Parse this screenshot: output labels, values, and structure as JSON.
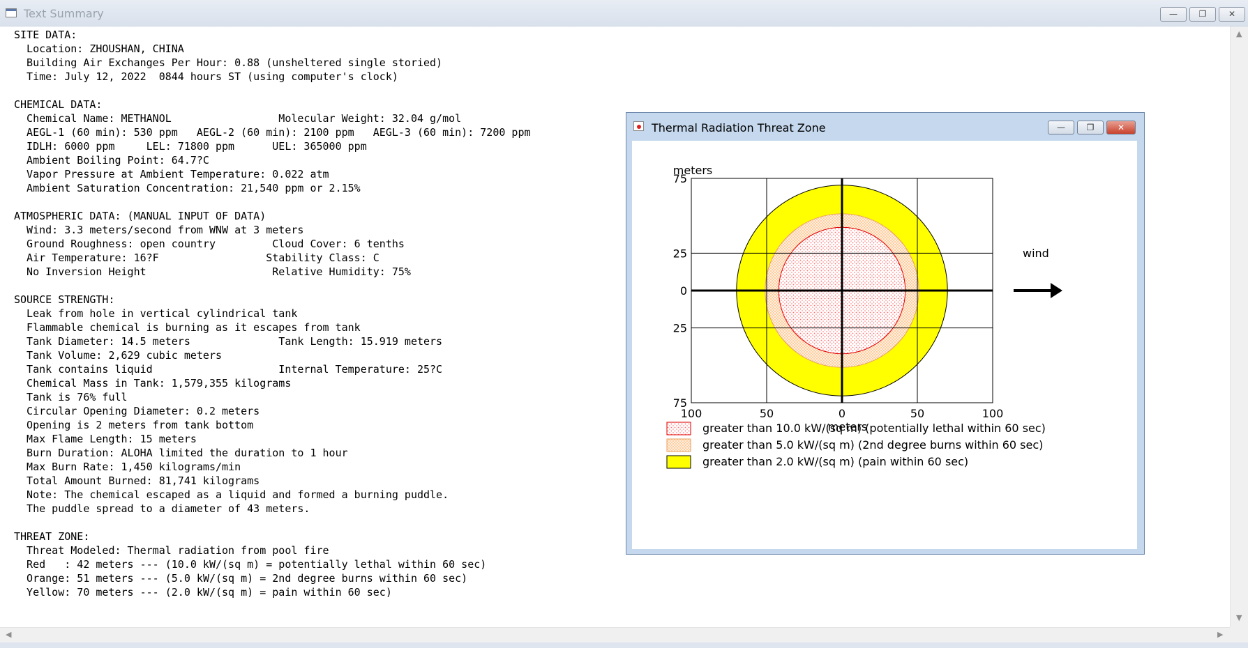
{
  "window": {
    "title": "Text Summary",
    "buttons": {
      "minimize": "—",
      "maximize": "❐",
      "close": "✕"
    }
  },
  "summary_lines": [
    "SITE DATA:",
    "  Location: ZHOUSHAN, CHINA",
    "  Building Air Exchanges Per Hour: 0.88 (unsheltered single storied)",
    "  Time: July 12, 2022  0844 hours ST (using computer's clock)",
    "",
    "CHEMICAL DATA:",
    "  Chemical Name: METHANOL                 Molecular Weight: 32.04 g/mol",
    "  AEGL-1 (60 min): 530 ppm   AEGL-2 (60 min): 2100 ppm   AEGL-3 (60 min): 7200 ppm",
    "  IDLH: 6000 ppm     LEL: 71800 ppm      UEL: 365000 ppm",
    "  Ambient Boiling Point: 64.7?C",
    "  Vapor Pressure at Ambient Temperature: 0.022 atm",
    "  Ambient Saturation Concentration: 21,540 ppm or 2.15%",
    "",
    "ATMOSPHERIC DATA: (MANUAL INPUT OF DATA)",
    "  Wind: 3.3 meters/second from WNW at 3 meters",
    "  Ground Roughness: open country         Cloud Cover: 6 tenths",
    "  Air Temperature: 16?F                 Stability Class: C",
    "  No Inversion Height                    Relative Humidity: 75%",
    "",
    "SOURCE STRENGTH:",
    "  Leak from hole in vertical cylindrical tank",
    "  Flammable chemical is burning as it escapes from tank",
    "  Tank Diameter: 14.5 meters              Tank Length: 15.919 meters",
    "  Tank Volume: 2,629 cubic meters",
    "  Tank contains liquid                    Internal Temperature: 25?C",
    "  Chemical Mass in Tank: 1,579,355 kilograms",
    "  Tank is 76% full",
    "  Circular Opening Diameter: 0.2 meters",
    "  Opening is 2 meters from tank bottom",
    "  Max Flame Length: 15 meters",
    "  Burn Duration: ALOHA limited the duration to 1 hour",
    "  Max Burn Rate: 1,450 kilograms/min",
    "  Total Amount Burned: 81,741 kilograms",
    "  Note: The chemical escaped as a liquid and formed a burning puddle.",
    "  The puddle spread to a diameter of 43 meters.",
    "",
    "THREAT ZONE:",
    "  Threat Modeled: Thermal radiation from pool fire",
    "  Red   : 42 meters --- (10.0 kW/(sq m) = potentially lethal within 60 sec)",
    "  Orange: 51 meters --- (5.0 kW/(sq m) = 2nd degree burns within 60 sec)",
    "  Yellow: 70 meters --- (2.0 kW/(sq m) = pain within 60 sec)"
  ],
  "threat_window": {
    "title": "Thermal Radiation Threat Zone",
    "buttons": {
      "minimize": "—",
      "maximize": "❐",
      "close": "✕"
    }
  },
  "chart_data": {
    "type": "area",
    "xlabel": "meters",
    "ylabel": "meters",
    "xlim": [
      -100,
      100
    ],
    "ylim": [
      -75,
      75
    ],
    "x_ticks": [
      -100,
      -50,
      0,
      50,
      100
    ],
    "x_tick_labels": [
      "100",
      "50",
      "0",
      "50",
      "100"
    ],
    "y_ticks": [
      75,
      25,
      0,
      -25,
      -75
    ],
    "y_tick_labels": [
      "75",
      "25",
      "0",
      "25",
      "75"
    ],
    "grid": true,
    "wind_label": "wind",
    "wind_direction": "right",
    "zones": [
      {
        "name": "yellow",
        "radius": 70,
        "color": "#ffff00",
        "pattern": "solid",
        "legend": "greater than 2.0 kW/(sq m) (pain within 60 sec)"
      },
      {
        "name": "orange",
        "radius": 51,
        "color": "#ffcc99",
        "pattern": "dots",
        "legend": "greater than 5.0 kW/(sq m) (2nd degree burns within 60 sec)"
      },
      {
        "name": "red",
        "radius": 42,
        "color": "#ff8080",
        "pattern": "dots",
        "legend": "greater than 10.0 kW/(sq m) (potentially lethal within 60 sec)"
      }
    ],
    "legend_order": [
      "red",
      "orange",
      "yellow"
    ],
    "colors": {
      "yellow_border": "#000000",
      "orange_border": "#e8a060",
      "red_border": "#e00000"
    }
  }
}
